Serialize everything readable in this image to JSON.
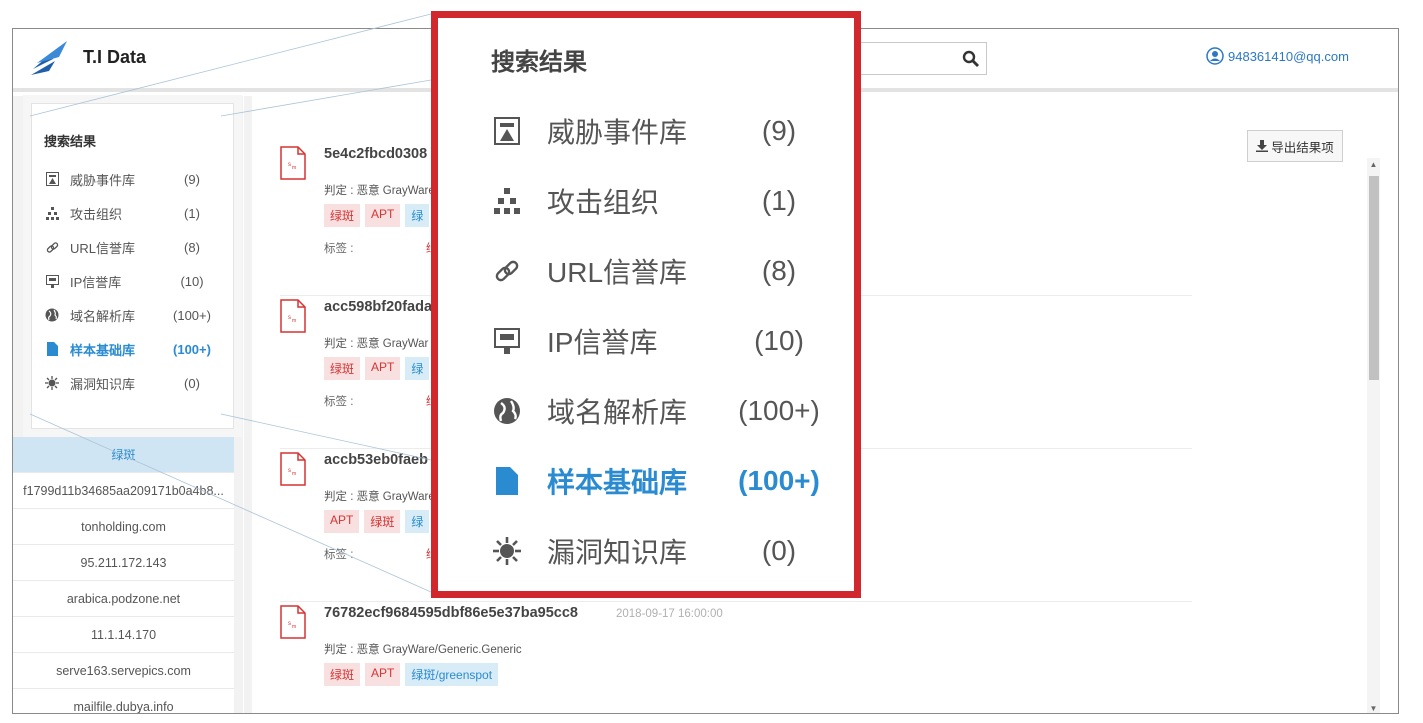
{
  "app": {
    "title": "T.I Data"
  },
  "user": {
    "email": "948361410@qq.com"
  },
  "search": {
    "placeholder": ""
  },
  "sidebar": {
    "heading": "搜索结果",
    "categories": [
      {
        "icon": "threat-event-icon",
        "label": "威胁事件库",
        "count": "(9)"
      },
      {
        "icon": "attack-org-icon",
        "label": "攻击组织",
        "count": "(1)"
      },
      {
        "icon": "link-icon",
        "label": "URL信誉库",
        "count": "(8)"
      },
      {
        "icon": "ip-icon",
        "label": "IP信誉库",
        "count": "(10)"
      },
      {
        "icon": "globe-icon",
        "label": "域名解析库",
        "count": "(100+)"
      },
      {
        "icon": "file-icon",
        "label": "样本基础库",
        "count": "(100+)",
        "active": true
      },
      {
        "icon": "bug-icon",
        "label": "漏洞知识库",
        "count": "(0)"
      }
    ],
    "filters": [
      "绿斑",
      "f1799d11b34685aa209171b0a4b8...",
      "tonholding.com",
      "95.211.172.143",
      "arabica.podzone.net",
      "11.1.14.170",
      "serve163.servepics.com",
      "mailfile.dubya.info"
    ]
  },
  "main": {
    "export_label": "导出结果项",
    "results": [
      {
        "hash": "5e4c2fbcd0308",
        "date": "",
        "judge": "判定 : 恶意 GrayWare",
        "tags": [
          {
            "text": "绿斑",
            "color": "red"
          },
          {
            "text": "APT",
            "color": "red"
          },
          {
            "text": "绿",
            "color": "blue"
          }
        ],
        "tag_label": "标签 :",
        "tag_value": "绿"
      },
      {
        "hash": "acc598bf20fada",
        "date": "",
        "judge": "判定 : 恶意 GrayWar",
        "tags": [
          {
            "text": "绿斑",
            "color": "red"
          },
          {
            "text": "APT",
            "color": "red"
          },
          {
            "text": "绿",
            "color": "blue"
          }
        ],
        "tag_label": "标签 :",
        "tag_value": "绿"
      },
      {
        "hash": "accb53eb0faeb",
        "date": "",
        "judge": "判定 : 恶意 GrayWare",
        "tags": [
          {
            "text": "APT",
            "color": "red"
          },
          {
            "text": "绿斑",
            "color": "red"
          },
          {
            "text": "绿",
            "color": "blue"
          }
        ],
        "tag_label": "标签 :",
        "tag_value": "绿"
      },
      {
        "hash": "76782ecf9684595dbf86e5e37ba95cc8",
        "date": "2018-09-17 16:00:00",
        "judge": "判定 : 恶意 GrayWare/Generic.Generic",
        "tags": [
          {
            "text": "绿斑",
            "color": "red"
          },
          {
            "text": "APT",
            "color": "red"
          },
          {
            "text": "绿斑/greenspot",
            "color": "blue"
          }
        ],
        "tag_label": "",
        "tag_value": ""
      }
    ]
  },
  "callout": {
    "heading": "搜索结果"
  },
  "colors": {
    "accent": "#2a8bd0",
    "callout_border": "#d0282c",
    "tag_red": "#d53434"
  }
}
